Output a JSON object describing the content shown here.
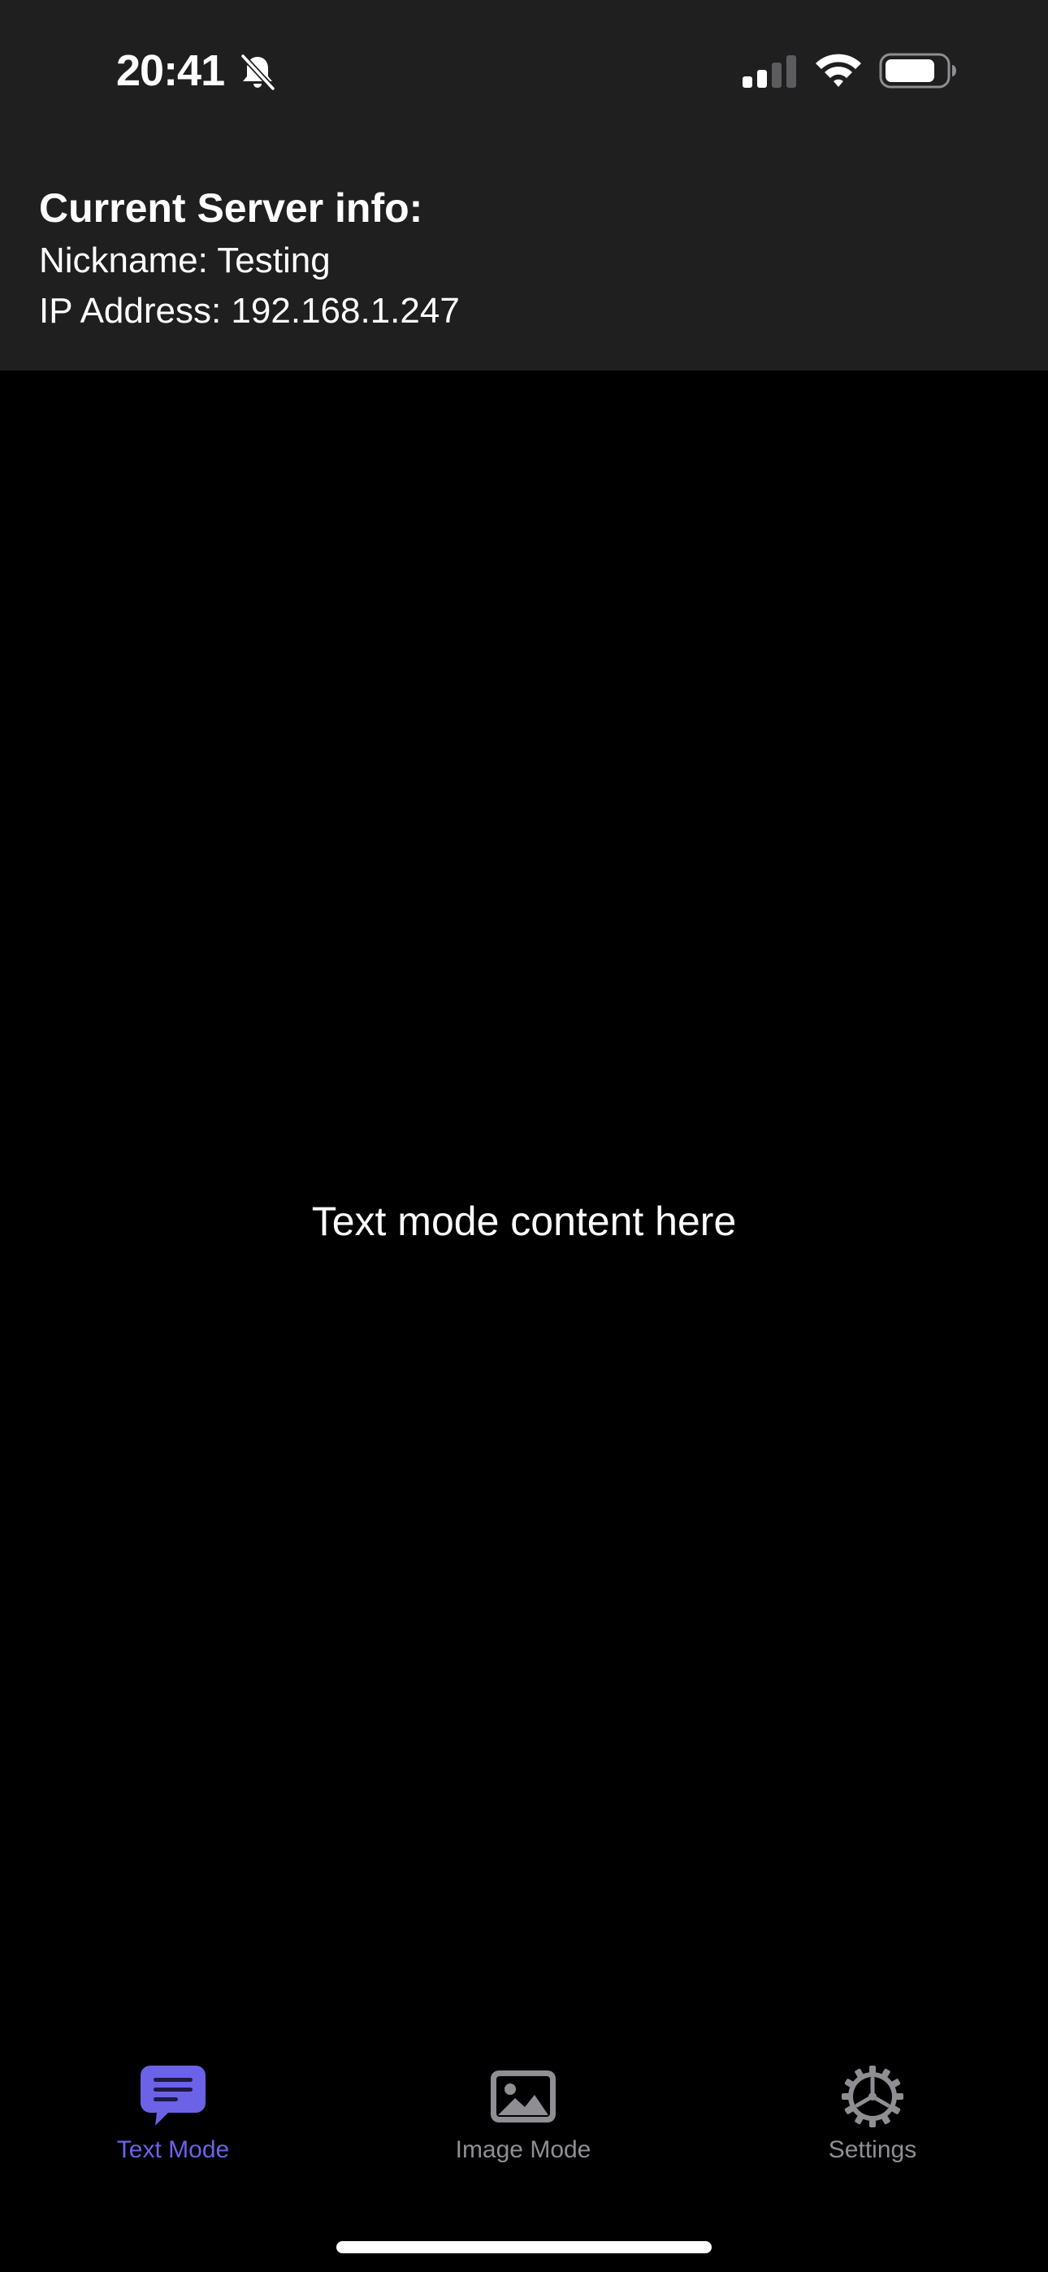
{
  "status_bar": {
    "time": "20:41",
    "icons": [
      "bell-slash-icon",
      "cellular-signal-icon",
      "wifi-icon",
      "battery-icon"
    ]
  },
  "server_info": {
    "title": "Current Server info:",
    "nickname": "Nickname: Testing",
    "ip_address": "IP Address: 192.168.1.247"
  },
  "main": {
    "text": "Text mode content here"
  },
  "tab_bar": {
    "tabs": [
      {
        "label": "Text Mode",
        "icon": "message-bubble-icon",
        "selected": true
      },
      {
        "label": "Image Mode",
        "icon": "photo-icon",
        "selected": false
      },
      {
        "label": "Settings",
        "icon": "gear-icon",
        "selected": false
      }
    ]
  },
  "colors": {
    "header_background": "#1f1f1f",
    "background": "#000000",
    "text": "#ffffff",
    "active_tab": "#6b62e8",
    "inactive_tab": "#8e8e93"
  }
}
